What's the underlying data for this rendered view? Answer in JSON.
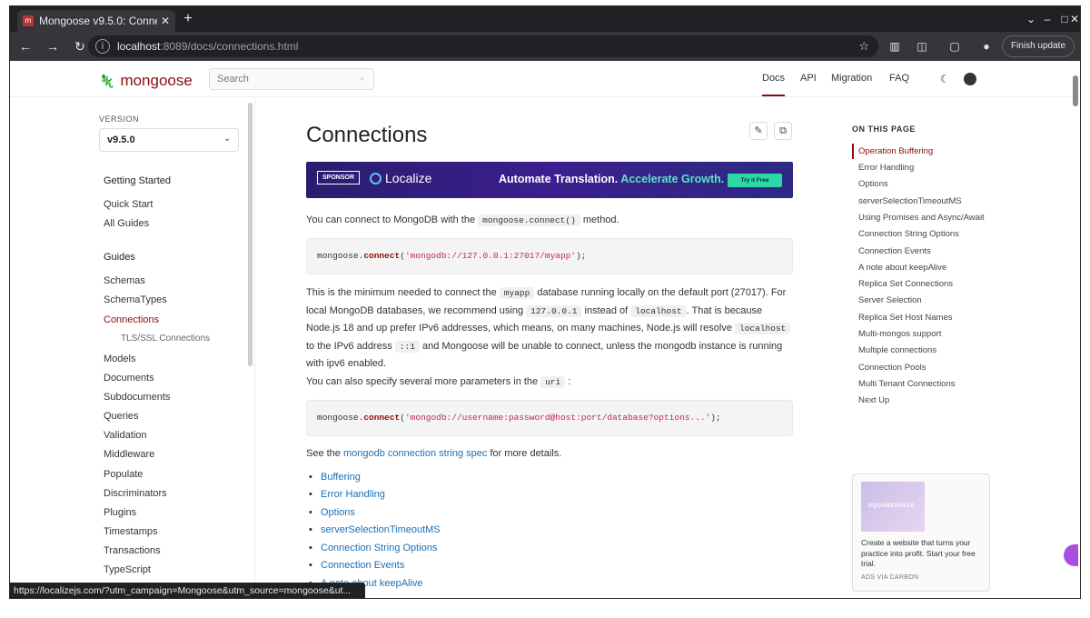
{
  "browser": {
    "tab_title": "Mongoose v9.5.0: Conne",
    "url_host": "localhost",
    "url_path": ":8089/docs/connections.html",
    "finish_update": "Finish update",
    "status_url": "https://localizejs.com/?utm_campaign=Mongoose&utm_source=mongoose&ut..."
  },
  "header": {
    "logo_text": "mongoose",
    "search_placeholder": "Search",
    "nav": [
      "Docs",
      "API",
      "Migration",
      "FAQ"
    ]
  },
  "sidebar": {
    "version_label": "VERSION",
    "version_value": "v9.5.0",
    "getting_started": "Getting Started",
    "gs_items": [
      "Quick Start",
      "All Guides"
    ],
    "guides": "Guides",
    "items": [
      "Schemas",
      "SchemaTypes",
      "Connections",
      "Models",
      "Documents",
      "Subdocuments",
      "Queries",
      "Validation",
      "Middleware",
      "Populate",
      "Discriminators",
      "Plugins",
      "Timestamps",
      "Transactions",
      "TypeScript"
    ],
    "sub_item": "TLS/SSL Connections"
  },
  "main": {
    "title": "Connections",
    "banner": {
      "sponsor": "SPONSOR",
      "brand": "Localize",
      "tagline_a": "Automate Translation.",
      "tagline_b": "Accelerate Growth.",
      "cta": "Try it Free"
    },
    "p1_a": "You can connect to MongoDB with the",
    "p1_code": "mongoose.connect()",
    "p1_b": "method.",
    "code1": {
      "obj": "mongoose.",
      "fn": "connect",
      "open": "(",
      "str": "'mongodb://127.0.0.1:27017/myapp'",
      "close": ");"
    },
    "p2": {
      "t1": "This is the minimum needed to connect the",
      "c1": "myapp",
      "t2": "database running locally on the default port (27017). For local MongoDB databases, we recommend using",
      "c2": "127.0.0.1",
      "t3": "instead of",
      "c3": "localhost",
      "t4": ". That is because Node.js 18 and up prefer IPv6 addresses, which means, on many machines, Node.js will resolve",
      "c4": "localhost",
      "t5": "to the IPv6 address",
      "c5": "::1",
      "t6": "and Mongoose will be unable to connect, unless the mongodb instance is running with ipv6 enabled."
    },
    "p3_a": "You can also specify several more parameters in the",
    "p3_code": "uri",
    "p3_b": ":",
    "code2": {
      "obj": "mongoose.",
      "fn": "connect",
      "open": "(",
      "str": "'mongodb://username:password@host:port/database?options...'",
      "close": ");"
    },
    "p4_a": "See the",
    "p4_link": "mongodb connection string spec",
    "p4_b": "for more details.",
    "bullets": [
      "Buffering",
      "Error Handling",
      "Options",
      "serverSelectionTimeoutMS",
      "Connection String Options",
      "Connection Events",
      "A note about keepAlive"
    ]
  },
  "toc": {
    "title": "ON THIS PAGE",
    "items": [
      "Operation Buffering",
      "Error Handling",
      "Options",
      "serverSelectionTimeoutMS",
      "Using Promises and Async/Await",
      "Connection String Options",
      "Connection Events",
      "A note about keepAlive",
      "Replica Set Connections",
      "Server Selection",
      "Replica Set Host Names",
      "Multi-mongos support",
      "Multiple connections",
      "Connection Pools",
      "Multi Tenant Connections",
      "Next Up"
    ]
  },
  "ad": {
    "brand": "SQUARESPACE",
    "text": "Create a website that turns your practice into profit. Start your free trial.",
    "via": "ADS VIA CARBON"
  },
  "colors": {
    "accent": "#8b0d0d",
    "link": "#1a6fb5",
    "cta": "#2bd9a6"
  }
}
